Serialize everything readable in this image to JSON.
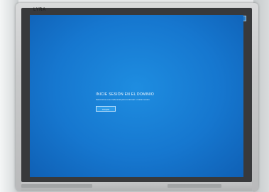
{
  "monitor": {
    "brand": "LYRA"
  },
  "login_screen": {
    "title": "INICIE SESIÓN EN EL DOMINIO",
    "subtitle": "Seleccione una credencial para continuar o iniciar sesión",
    "accept_label": "Aceptar"
  },
  "colors": {
    "screen_blue": "#1677cf",
    "button_blue": "#2d9bea"
  }
}
